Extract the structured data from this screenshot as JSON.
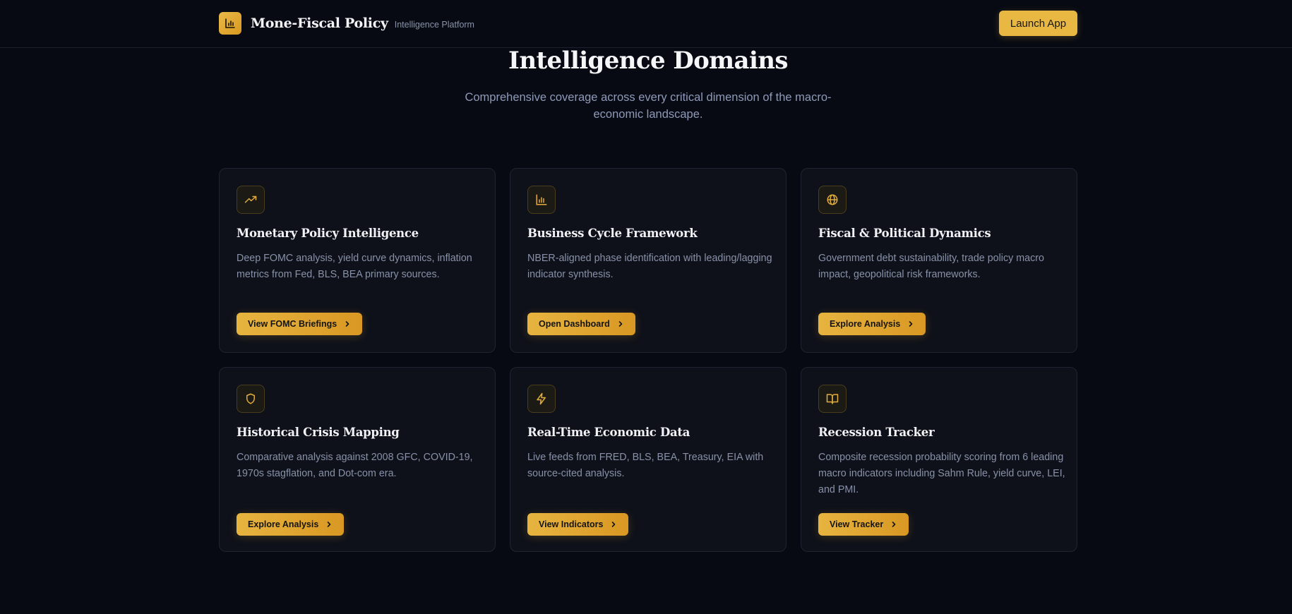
{
  "header": {
    "brand_name": "Mone-Fiscal Policy",
    "brand_sub": "Intelligence Platform",
    "launch_label": "Launch App",
    "logo_icon": "bar-chart-icon"
  },
  "section": {
    "title": "Intelligence Domains",
    "subtitle": "Comprehensive coverage across every critical dimension of the macro-economic landscape."
  },
  "colors": {
    "background": "#070a13",
    "card": "#0e111a",
    "accent": "#e8b843",
    "muted_text": "#8891a8"
  },
  "cards": [
    {
      "icon": "trending-up-icon",
      "title": "Monetary Policy Intelligence",
      "description": "Deep FOMC analysis, yield curve dynamics, inflation metrics from Fed, BLS, BEA primary sources.",
      "button": "View FOMC Briefings"
    },
    {
      "icon": "bar-chart-icon",
      "title": "Business Cycle Framework",
      "description": "NBER-aligned phase identification with leading/lagging indicator synthesis.",
      "button": "Open Dashboard"
    },
    {
      "icon": "globe-icon",
      "title": "Fiscal & Political Dynamics",
      "description": "Government debt sustainability, trade policy macro impact, geopolitical risk frameworks.",
      "button": "Explore Analysis"
    },
    {
      "icon": "shield-icon",
      "title": "Historical Crisis Mapping",
      "description": "Comparative analysis against 2008 GFC, COVID-19, 1970s stagflation, and Dot-com era.",
      "button": "Explore Analysis"
    },
    {
      "icon": "lightning-icon",
      "title": "Real-Time Economic Data",
      "description": "Live feeds from FRED, BLS, BEA, Treasury, EIA with source-cited analysis.",
      "button": "View Indicators"
    },
    {
      "icon": "book-open-icon",
      "title": "Recession Tracker",
      "description": "Composite recession probability scoring from 6 leading macro indicators including Sahm Rule, yield curve, LEI, and PMI.",
      "button": "View Tracker"
    }
  ]
}
